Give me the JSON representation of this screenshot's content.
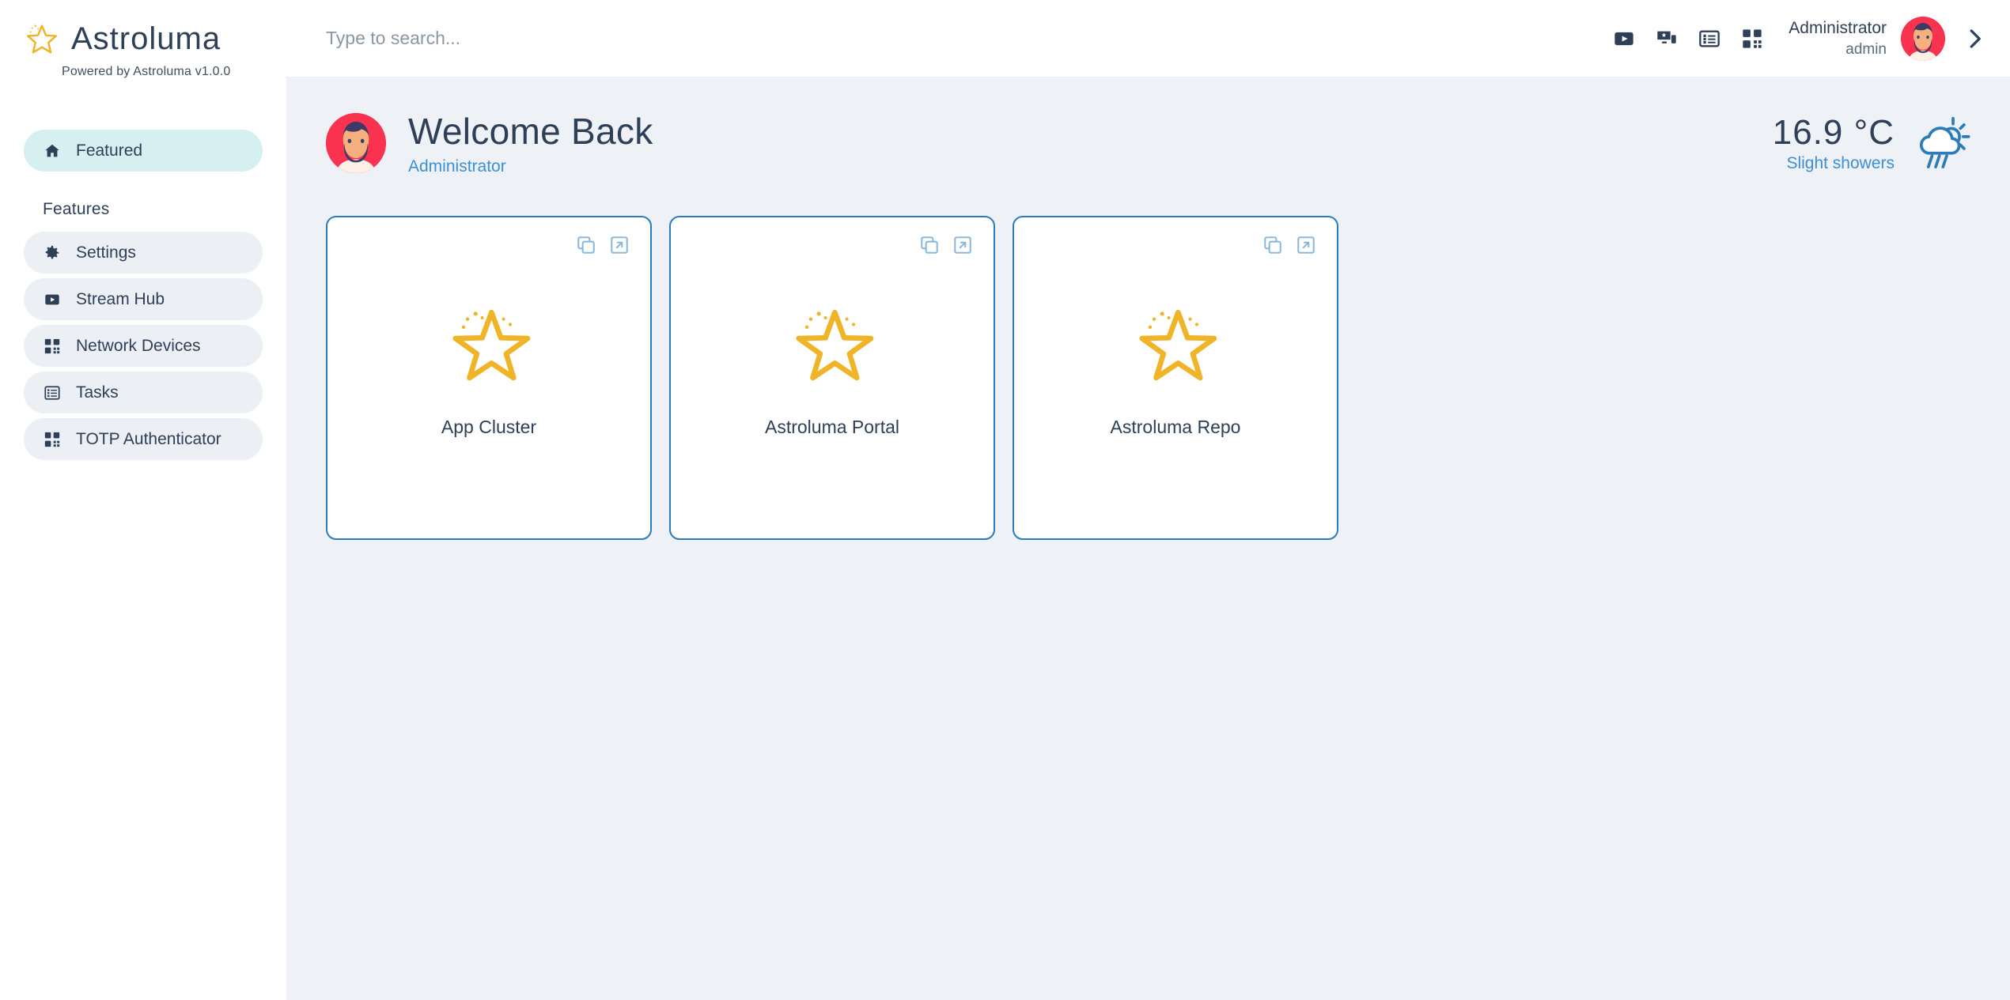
{
  "brand": {
    "name": "Astroluma",
    "tagline": "Powered by Astroluma v1.0.0",
    "logo_icon": "star-icon",
    "accent_yellow": "#f0b429",
    "accent_blue": "#2b7cb8"
  },
  "sidebar": {
    "primary": [
      {
        "label": "Featured",
        "icon": "home-icon",
        "active": true
      }
    ],
    "section_label": "Features",
    "items": [
      {
        "label": "Settings",
        "icon": "gear-icon"
      },
      {
        "label": "Stream Hub",
        "icon": "play-icon"
      },
      {
        "label": "Network Devices",
        "icon": "qr-code-icon"
      },
      {
        "label": "Tasks",
        "icon": "list-icon"
      },
      {
        "label": "TOTP Authenticator",
        "icon": "qr-code-icon"
      }
    ]
  },
  "topbar": {
    "search": {
      "placeholder": "Type to search...",
      "value": ""
    },
    "icons": [
      {
        "name": "play-icon"
      },
      {
        "name": "devices-icon"
      },
      {
        "name": "list-icon"
      },
      {
        "name": "qr-code-icon"
      }
    ],
    "user": {
      "name": "Administrator",
      "handle": "admin",
      "avatar": "user-avatar"
    },
    "expand_icon": "chevron-right-icon"
  },
  "welcome": {
    "title": "Welcome Back",
    "subtitle": "Administrator",
    "avatar": "user-avatar"
  },
  "weather": {
    "temperature": "16.9 °C",
    "description": "Slight showers",
    "icon": "sun-cloud-rain-icon",
    "color": "#2b7cb8"
  },
  "cards": [
    {
      "label": "App Cluster",
      "icon": "star-icon",
      "copy_icon": "copy-icon",
      "open_icon": "external-link-icon"
    },
    {
      "label": "Astroluma Portal",
      "icon": "star-icon",
      "copy_icon": "copy-icon",
      "open_icon": "external-link-icon"
    },
    {
      "label": "Astroluma Repo",
      "icon": "star-icon",
      "copy_icon": "copy-icon",
      "open_icon": "external-link-icon"
    }
  ]
}
